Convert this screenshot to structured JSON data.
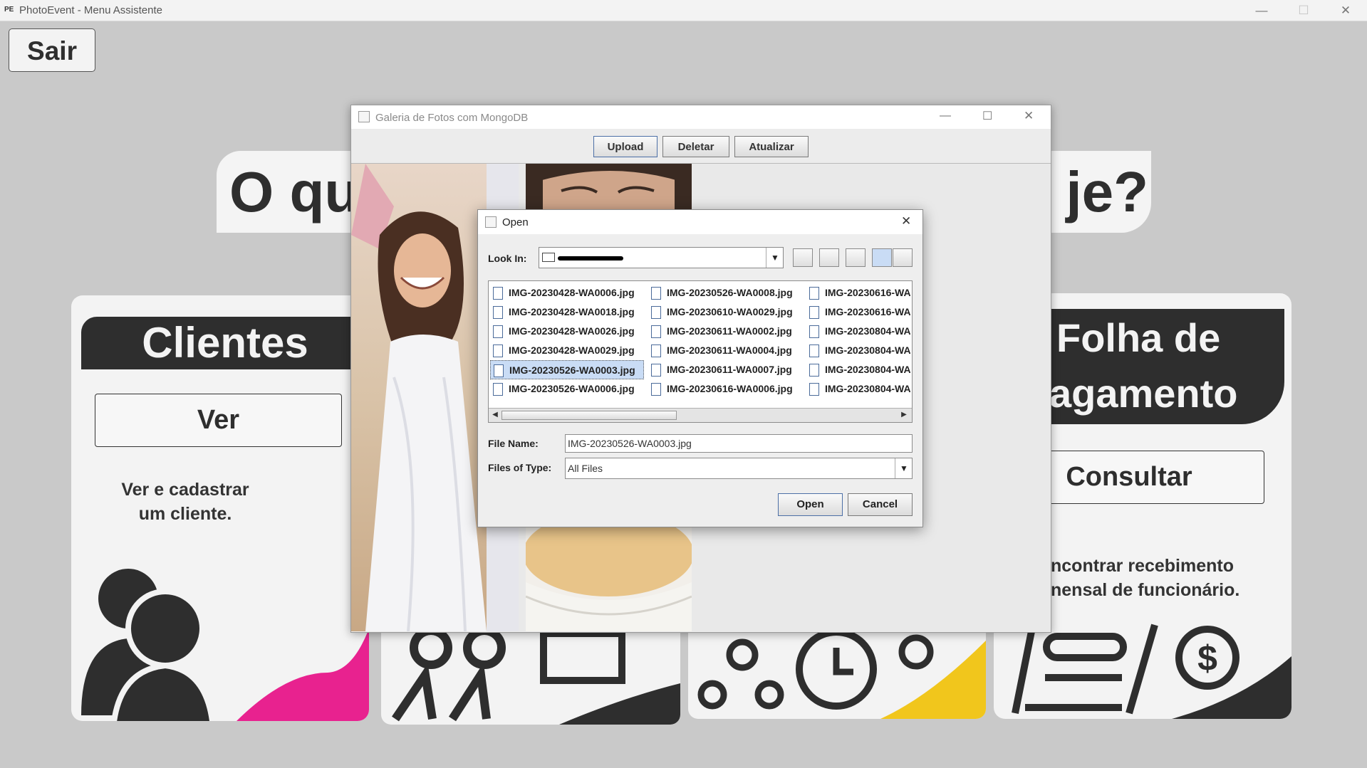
{
  "window": {
    "title": "PhotoEvent - Menu Assistente",
    "logo": "PE",
    "minimize": "—",
    "maximize": "☐",
    "close": "✕"
  },
  "main": {
    "exit_label": "Sair",
    "headline_left": "O qu",
    "headline_right": "je?",
    "clientes": {
      "title": "Clientes",
      "button": "Ver",
      "description": "Ver e cadastrar um cliente."
    },
    "folha": {
      "title_line1": "Folha de",
      "title_line2": "agamento",
      "button": "Consultar",
      "description_line1": "ncontrar recebimento",
      "description_line2": "nensal de funcionário."
    }
  },
  "gallery": {
    "title": "Galeria de Fotos com MongoDB",
    "buttons": {
      "upload": "Upload",
      "delete": "Deletar",
      "refresh": "Atualizar"
    }
  },
  "open_dialog": {
    "title": "Open",
    "look_in_label": "Look In:",
    "files": [
      "IMG-20230428-WA0006.jpg",
      "IMG-20230428-WA0018.jpg",
      "IMG-20230428-WA0026.jpg",
      "IMG-20230428-WA0029.jpg",
      "IMG-20230526-WA0003.jpg",
      "IMG-20230526-WA0006.jpg",
      "IMG-20230526-WA0008.jpg",
      "IMG-20230610-WA0029.jpg",
      "IMG-20230611-WA0002.jpg",
      "IMG-20230611-WA0004.jpg",
      "IMG-20230611-WA0007.jpg",
      "IMG-20230616-WA0006.jpg",
      "IMG-20230616-WA",
      "IMG-20230616-WA",
      "IMG-20230804-WA",
      "IMG-20230804-WA",
      "IMG-20230804-WA",
      "IMG-20230804-WA"
    ],
    "selected_file": "IMG-20230526-WA0003.jpg",
    "file_name_label": "File Name:",
    "file_name_value": "IMG-20230526-WA0003.jpg",
    "files_of_type_label": "Files of Type:",
    "files_of_type_value": "All Files",
    "open_button": "Open",
    "cancel_button": "Cancel"
  },
  "colors": {
    "dark": "#2e2e2e",
    "pink": "#e8228f",
    "yellow": "#f1c61c",
    "background": "#c9c9c9",
    "card": "#f3f3f3"
  }
}
